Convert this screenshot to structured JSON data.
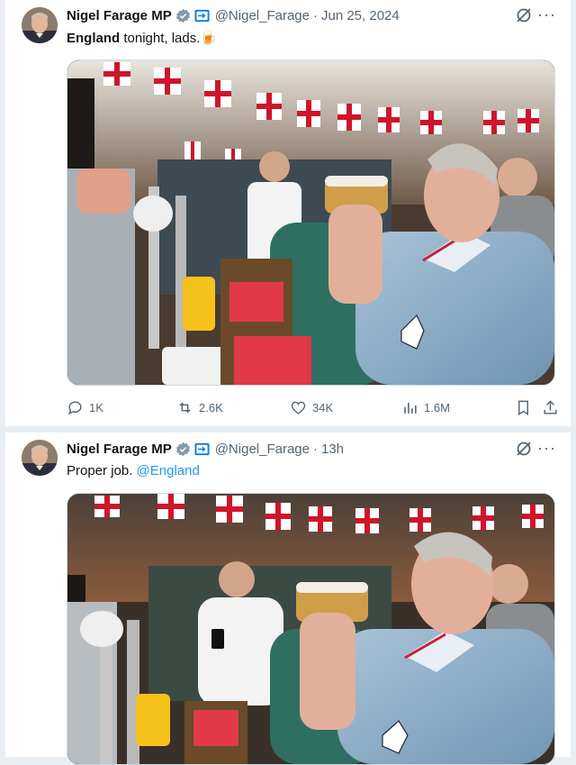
{
  "tweets": [
    {
      "author": "Nigel Farage MP",
      "handle": "@Nigel_Farage",
      "separator": "·",
      "time": "Jun 25, 2024",
      "text_bold": "England",
      "text_rest": " tonight, lads.",
      "emoji": "🍺",
      "metrics": {
        "replies": "1K",
        "reposts": "2.6K",
        "likes": "34K",
        "views": "1.6M"
      }
    },
    {
      "author": "Nigel Farage MP",
      "handle": "@Nigel_Farage",
      "separator": "·",
      "time": "13h",
      "text": "Proper job. ",
      "mention": "@England"
    }
  ],
  "more_label": "···",
  "colors": {
    "accent": "#1d9bf0",
    "muted": "#536471",
    "verified": "#829aab"
  }
}
